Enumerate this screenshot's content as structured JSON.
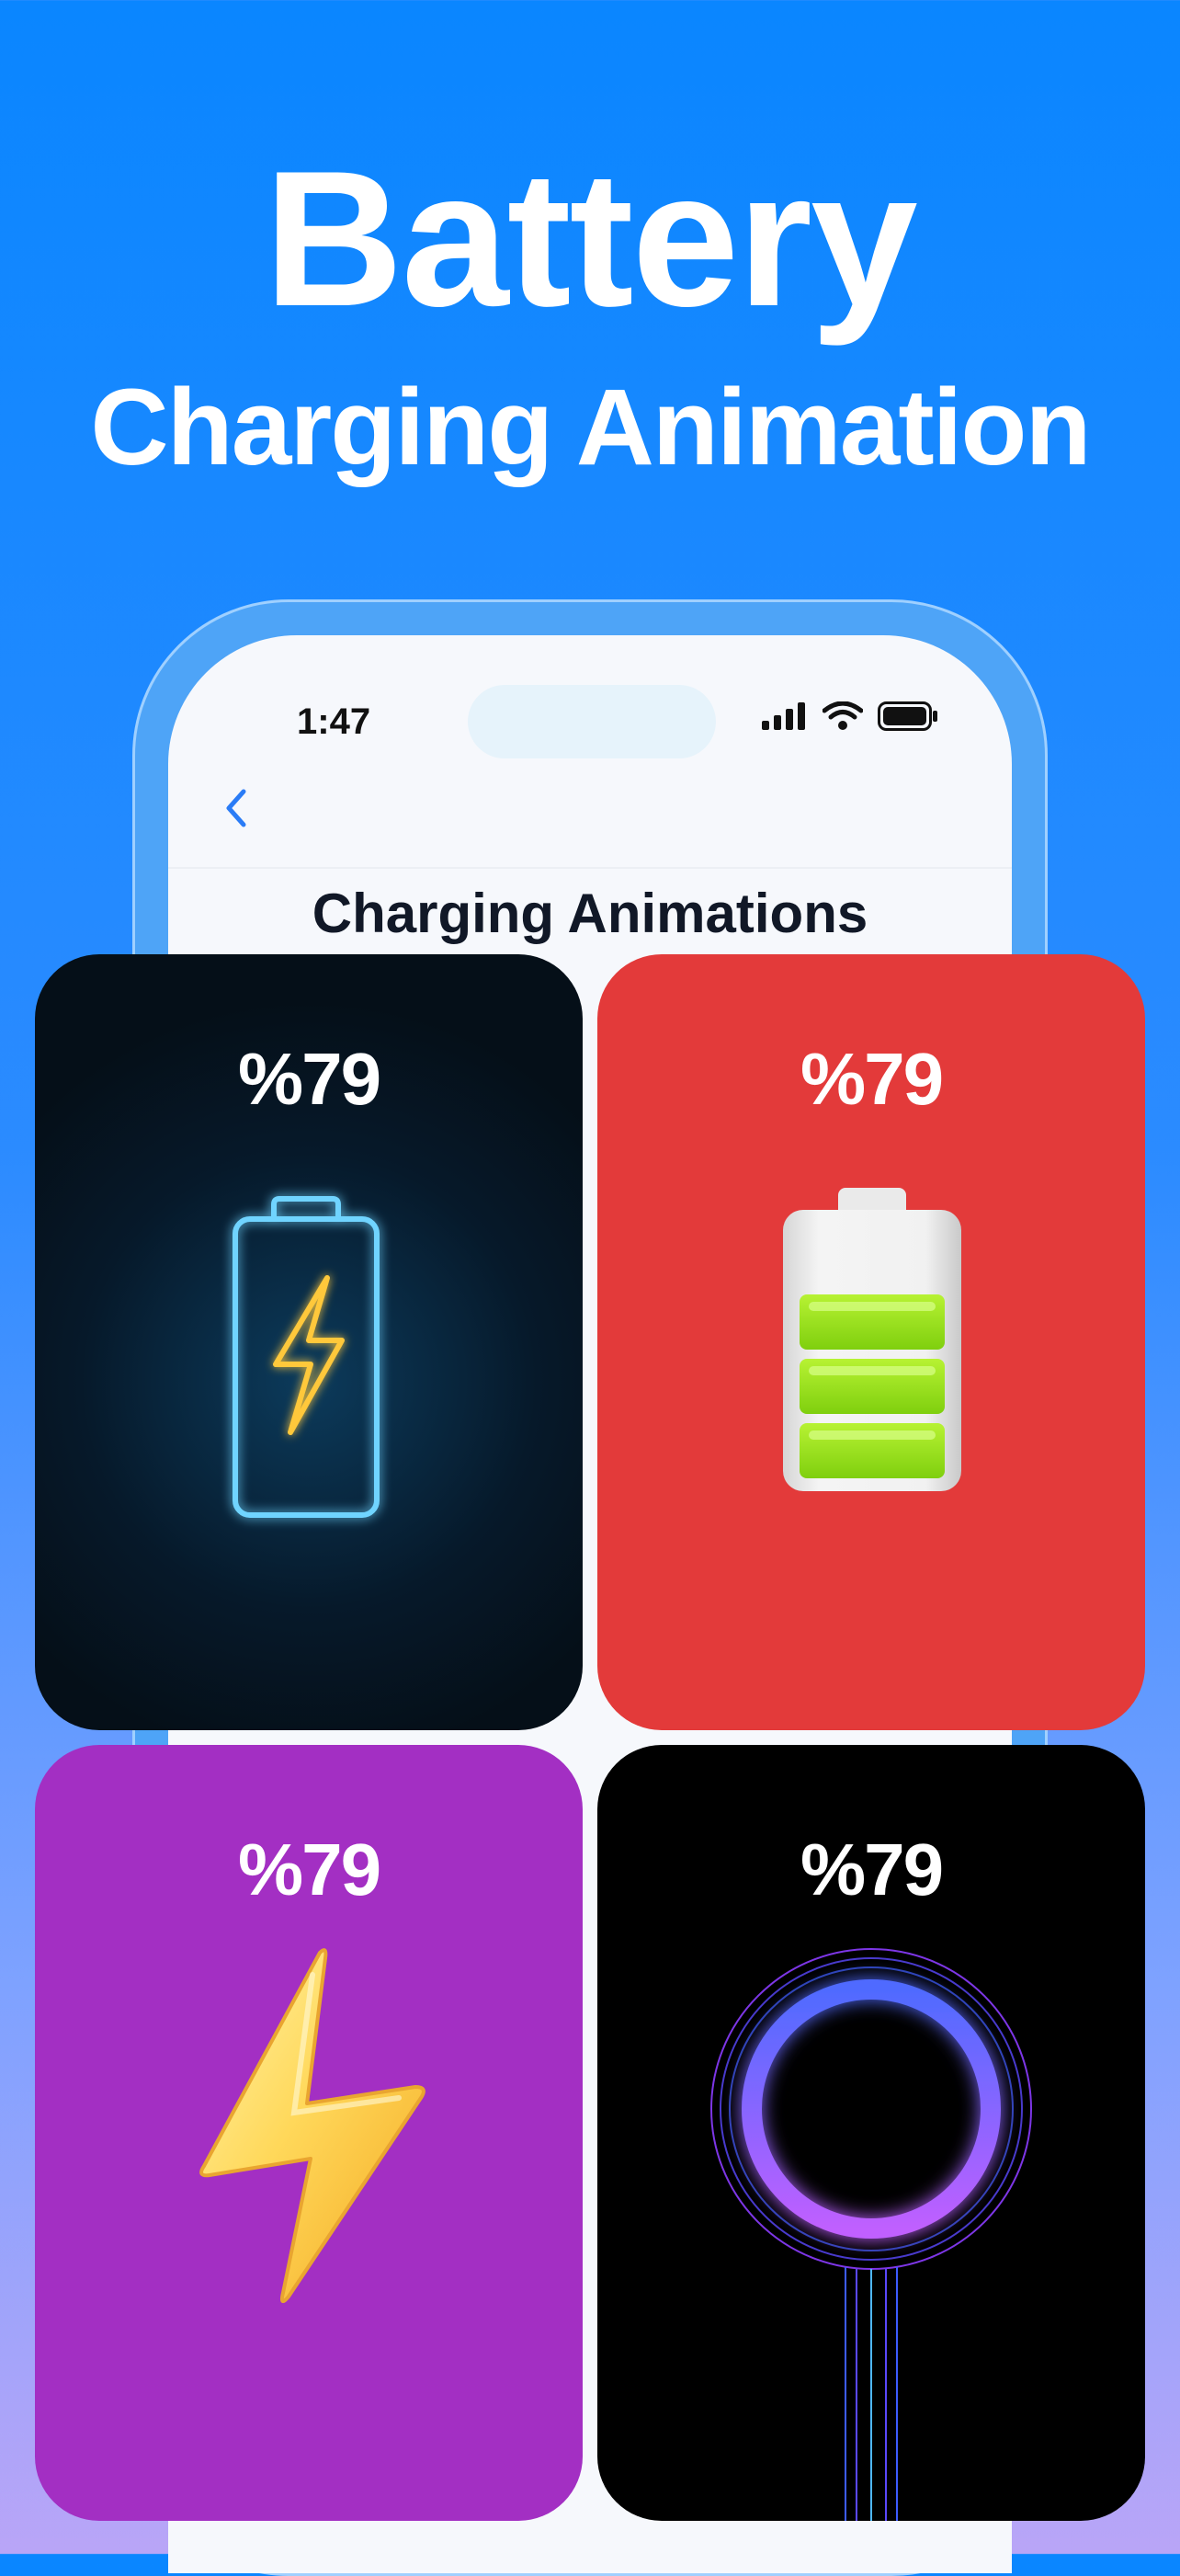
{
  "hero": {
    "title_line1": "Battery",
    "title_line2": "Charging Animation"
  },
  "status_bar": {
    "time": "1:47"
  },
  "screen": {
    "title": "Charging Animations"
  },
  "cards": [
    {
      "percent": "%79",
      "style": "neon-battery",
      "background": "#06192a"
    },
    {
      "percent": "%79",
      "style": "3d-battery",
      "background": "#e33a3a"
    },
    {
      "percent": "%79",
      "style": "3d-lightning",
      "background": "#a32fc3"
    },
    {
      "percent": "%79",
      "style": "glow-ring",
      "background": "#000000"
    }
  ],
  "colors": {
    "brand_blue": "#0a86ff",
    "neon_blue": "#4cc6ff",
    "bolt_yellow": "#ffc83a",
    "battery_green": "#9be21a",
    "ring_purple": "#8b5cff"
  },
  "icons": [
    "back-chevron-icon",
    "signal-icon",
    "wifi-icon",
    "battery-status-icon"
  ]
}
